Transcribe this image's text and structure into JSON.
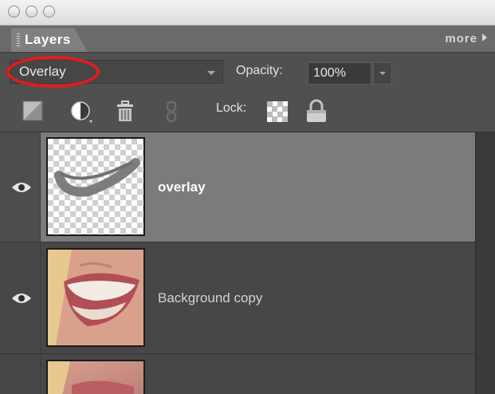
{
  "tab": {
    "label": "Layers"
  },
  "more_menu": {
    "label": "more"
  },
  "options": {
    "blend_mode": "Overlay",
    "opacity_label": "Opacity:",
    "opacity_value": "100%"
  },
  "toolbar": {
    "icons": [
      "new-layer-icon",
      "adjustment-layer-icon",
      "trash-icon",
      "link-icon"
    ],
    "lock_label": "Lock:"
  },
  "layers": [
    {
      "name": "overlay",
      "selected": true,
      "visible": true
    },
    {
      "name": "Background copy",
      "selected": false,
      "visible": true
    },
    {
      "name": "",
      "selected": false,
      "visible": false
    }
  ],
  "colors": {
    "highlight_oval": "#e41b1b",
    "selected_row": "#7b7b7b",
    "row": "#474747",
    "panel": "#505050"
  }
}
